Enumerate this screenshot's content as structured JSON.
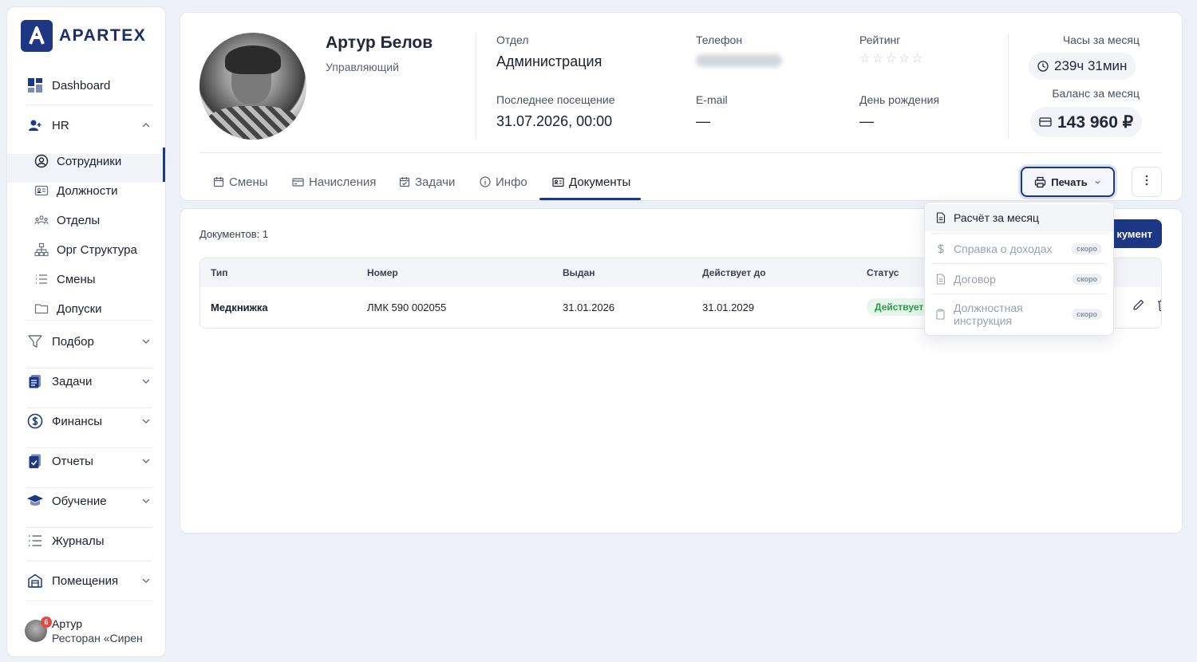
{
  "app": {
    "brand": "APARTEX"
  },
  "sidebar": {
    "items": [
      {
        "label": "Dashboard",
        "icon": "dashboard-icon"
      },
      {
        "label": "HR",
        "icon": "add-user-icon"
      },
      {
        "label": "Подбор",
        "icon": "filter-icon"
      },
      {
        "label": "Задачи",
        "icon": "tasks-icon"
      },
      {
        "label": "Финансы",
        "icon": "finance-icon"
      },
      {
        "label": "Отчеты",
        "icon": "reports-icon"
      },
      {
        "label": "Обучение",
        "icon": "graduation-cap-icon"
      },
      {
        "label": "Журналы",
        "icon": "list-icon"
      },
      {
        "label": "Помещения",
        "icon": "building-icon"
      }
    ],
    "hr_sub": [
      {
        "label": "Сотрудники",
        "icon": "user-circle-icon",
        "active": true
      },
      {
        "label": "Должности",
        "icon": "id-card-icon"
      },
      {
        "label": "Отделы",
        "icon": "team-icon"
      },
      {
        "label": "Орг Структура",
        "icon": "org-chart-icon"
      },
      {
        "label": "Смены",
        "icon": "list-icon"
      },
      {
        "label": "Допуски",
        "icon": "folder-icon"
      }
    ],
    "user": {
      "name": "Артур",
      "org": "Ресторан «Сирен",
      "badge": "6"
    }
  },
  "profile": {
    "name": "Артур Белов",
    "role": "Управляющий",
    "department_label": "Отдел",
    "department": "Администрация",
    "phone_label": "Телефон",
    "rating_label": "Рейтинг",
    "rating": 0,
    "last_visit_label": "Последнее посещение",
    "last_visit": "31.07.2026, 00:00",
    "email_label": "E-mail",
    "email": "—",
    "birthday_label": "День рождения",
    "birthday": "—",
    "hours_label": "Часы за месяц",
    "hours": "239ч 31мин",
    "balance_label": "Баланс за месяц",
    "balance": "143 960 ₽"
  },
  "tabs": [
    {
      "label": "Смены",
      "icon": "calendar-icon"
    },
    {
      "label": "Начисления",
      "icon": "card-icon"
    },
    {
      "label": "Задачи",
      "icon": "calendar-check-icon"
    },
    {
      "label": "Инфо",
      "icon": "info-icon"
    },
    {
      "label": "Документы",
      "icon": "document-id-icon",
      "active": true
    }
  ],
  "actions": {
    "print": "Печать",
    "add_document_partial": "кумент"
  },
  "documents": {
    "count_text": "Документов: 1",
    "columns": [
      "Тип",
      "Номер",
      "Выдан",
      "Действует до",
      "Статус"
    ],
    "rows": [
      {
        "type": "Медкнижка",
        "number": "ЛМК 590 002055",
        "issued": "31.01.2026",
        "valid_until": "31.01.2029",
        "status": "Действует"
      }
    ]
  },
  "print_menu": {
    "items": [
      {
        "label": "Расчёт за месяц",
        "icon": "document-icon",
        "enabled": true
      },
      {
        "label": "Справка о доходах",
        "icon": "dollar-icon",
        "soon": "скоро"
      },
      {
        "label": "Договор",
        "icon": "document-icon",
        "soon": "скоро"
      },
      {
        "label": "Должностная инструкция",
        "icon": "clipboard-icon",
        "soon": "скоро"
      }
    ]
  },
  "colors": {
    "brand": "#1d3784",
    "status_ok": "#2a9a47",
    "background": "#eef0f8"
  }
}
